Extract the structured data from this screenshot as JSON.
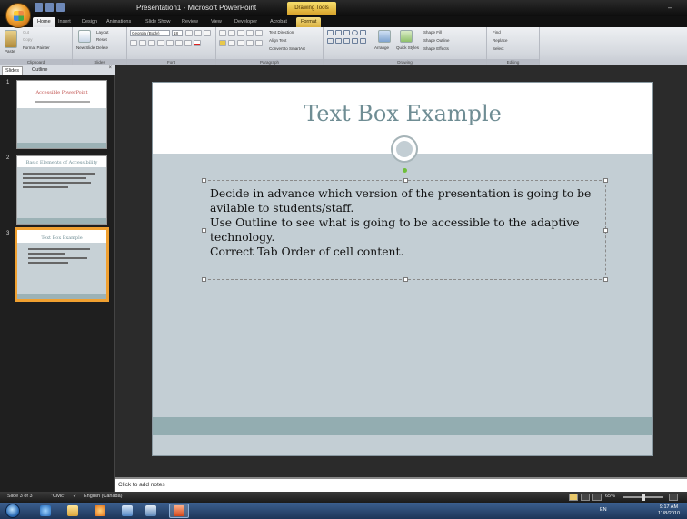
{
  "window": {
    "title": "Presentation1 - Microsoft PowerPoint",
    "contextual_tab_group": "Drawing Tools",
    "minimize_glyph": "–"
  },
  "ribbon_tabs": [
    "Home",
    "Insert",
    "Design",
    "Animations",
    "Slide Show",
    "Review",
    "View",
    "Developer",
    "Acrobat",
    "Format"
  ],
  "ribbon": {
    "clipboard": {
      "paste": "Paste",
      "cut": "Cut",
      "copy": "Copy",
      "format_painter": "Format Painter",
      "label": "Clipboard"
    },
    "slides": {
      "new_slide": "New Slide",
      "layout": "Layout",
      "reset": "Reset",
      "delete": "Delete",
      "label": "Slides"
    },
    "font": {
      "font_name": "Georgia (Body)",
      "font_size": "18",
      "label": "Font"
    },
    "paragraph": {
      "text_direction": "Text Direction",
      "align_text": "Align Text",
      "convert_smartart": "Convert to SmartArt",
      "label": "Paragraph"
    },
    "drawing": {
      "arrange": "Arrange",
      "quick_styles": "Quick Styles",
      "shape_fill": "Shape Fill",
      "shape_outline": "Shape Outline",
      "shape_effects": "Shape Effects",
      "label": "Drawing"
    },
    "editing": {
      "find": "Find",
      "replace": "Replace",
      "select": "Select",
      "label": "Editing"
    }
  },
  "panel": {
    "tabs": [
      "Slides",
      "Outline"
    ],
    "close_glyph": "×",
    "thumbnails": [
      {
        "number": "1",
        "title": "Accessible PowerPoint",
        "title_color": "#c0504d"
      },
      {
        "number": "2",
        "title": "Basic Elements of Accessibility",
        "title_color": "#6f8d94"
      },
      {
        "number": "3",
        "title": "Text Box Example",
        "title_color": "#6f8d94"
      }
    ]
  },
  "slide": {
    "title": "Text Box Example",
    "body_lines": [
      "Decide in advance which version of the presentation is going to be",
      "avilable to students/staff.",
      "Use Outline to see what is going to be accessible to the adaptive",
      "technology.",
      "Correct Tab Order of cell content."
    ]
  },
  "notes": {
    "placeholder": "Click to add notes"
  },
  "statusbar": {
    "slide_info": "Slide 3 of 3",
    "theme": "\"Civic\"",
    "language": "English (Canada)",
    "zoom": "65%"
  },
  "taskbar": {
    "language": "EN",
    "time": "9:17 AM",
    "date": "11/8/2010"
  },
  "colors": {
    "accent": "#f0a030",
    "title_teal": "#6f8d94",
    "slide_bg": "#c3ced4",
    "band": "#93adb1",
    "thumb_red_title": "#c0504d"
  }
}
